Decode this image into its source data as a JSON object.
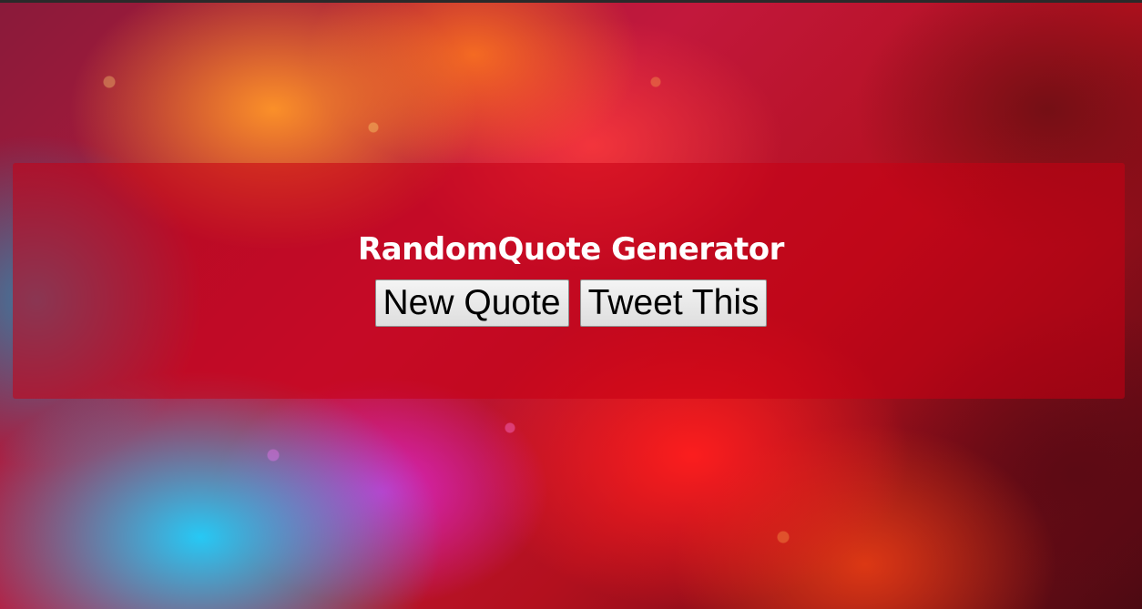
{
  "page": {
    "title": "RandomQuote Generator"
  },
  "buttons": {
    "new_quote": "New Quote",
    "tweet": "Tweet This"
  },
  "colors": {
    "panel_overlay": "#c80014",
    "title_text": "#ffffff",
    "button_text": "#000000",
    "button_face": "#efefef"
  }
}
